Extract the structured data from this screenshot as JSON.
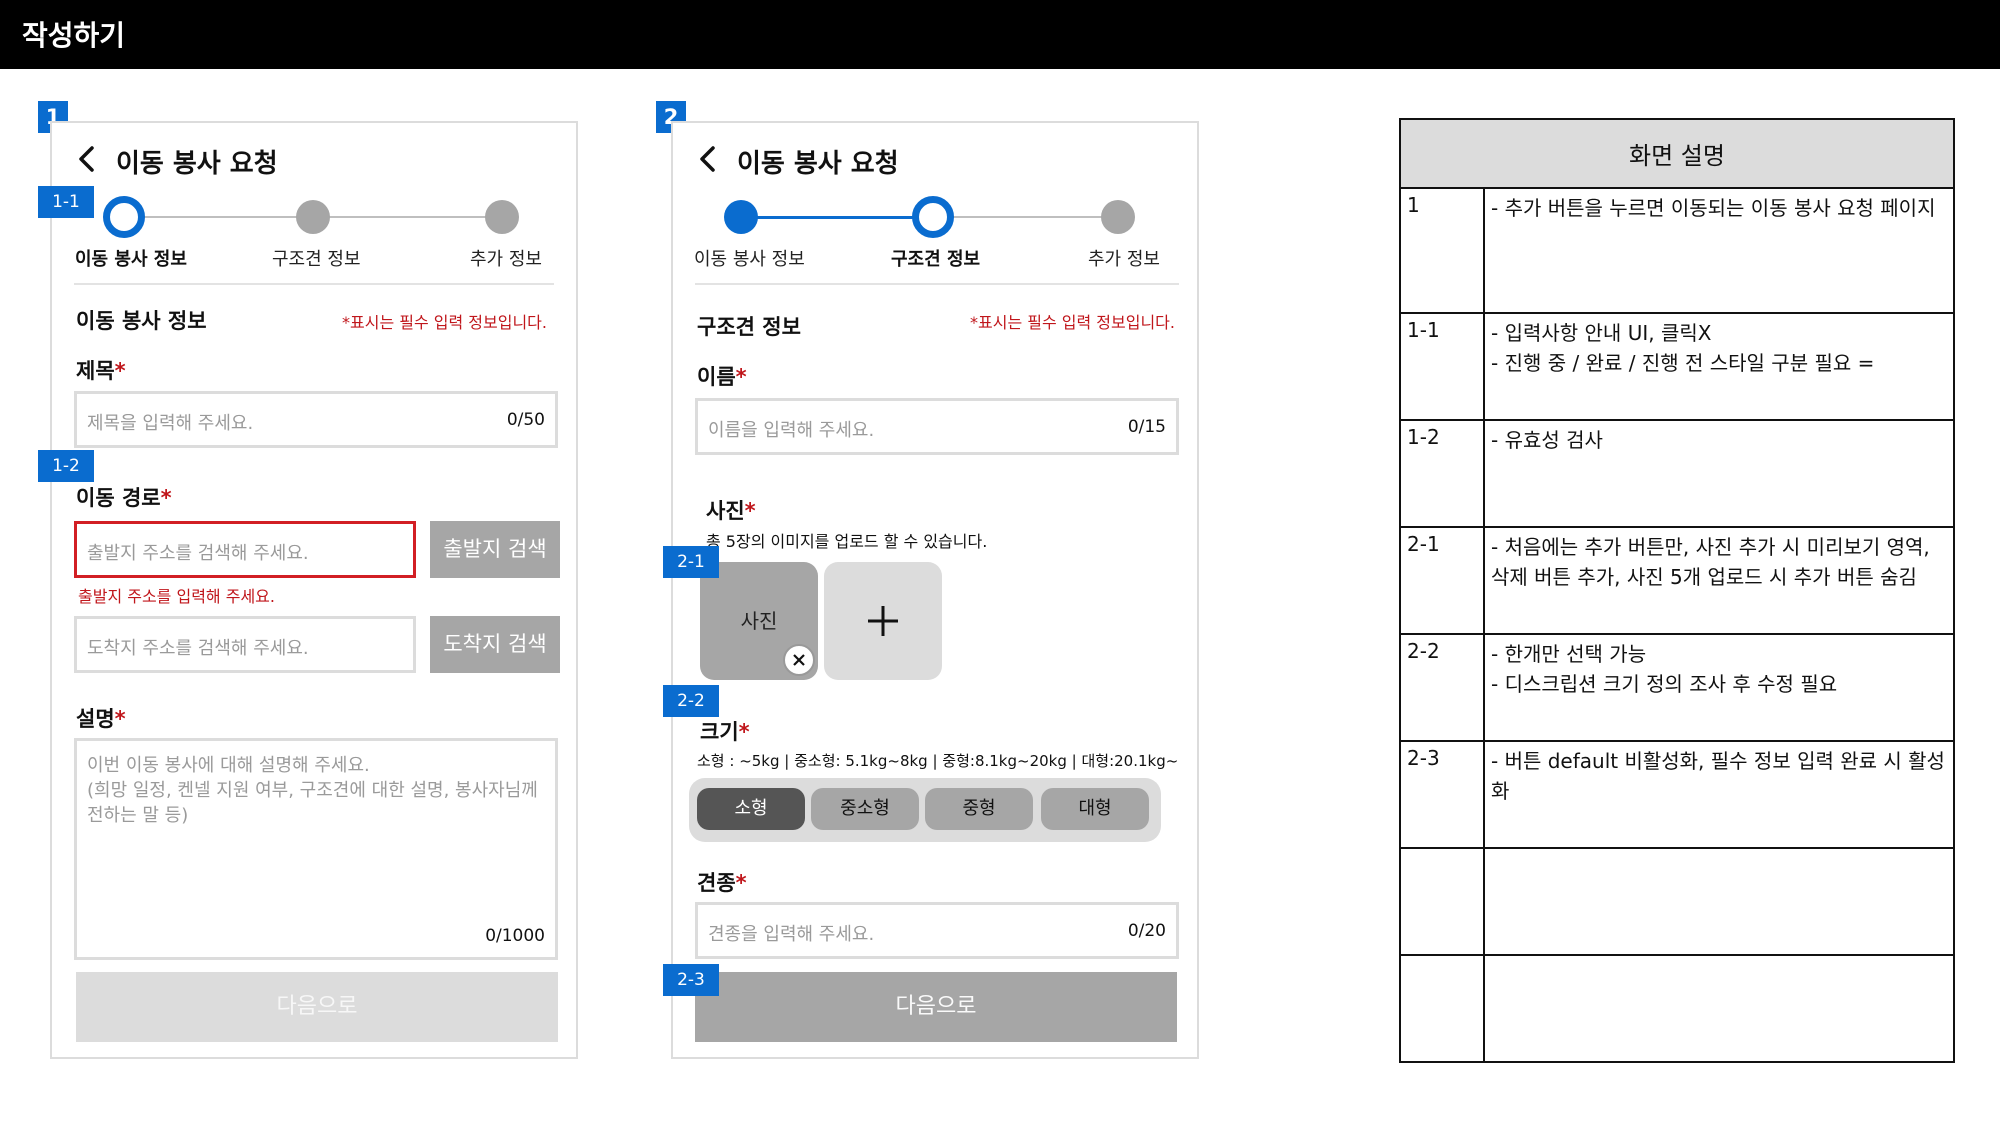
{
  "topbar": {
    "title": "작성하기"
  },
  "tags": {
    "s1": "1",
    "s1_1": "1-1",
    "s1_2": "1-2",
    "s2": "2",
    "s2_1": "2-1",
    "s2_2": "2-2",
    "s2_3": "2-3"
  },
  "screen1": {
    "header_title": "이동 봉사 요청",
    "steps": [
      {
        "label": "이동 봉사 정보",
        "state": "current"
      },
      {
        "label": "구조견 정보",
        "state": "pending"
      },
      {
        "label": "추가 정보",
        "state": "pending"
      }
    ],
    "section_title": "이동 봉사 정보",
    "required_note": "*표시는 필수 입력 정보입니다.",
    "title_field": {
      "label": "제목",
      "star": "*",
      "placeholder": "제목을 입력해 주세요.",
      "counter": "0/50"
    },
    "route": {
      "label": "이동 경로",
      "star": "*",
      "departure_placeholder": "출발지 주소를 검색해 주세요.",
      "departure_button": "출발지 검색",
      "departure_error": "출발지 주소를 입력해 주세요.",
      "arrival_placeholder": "도착지 주소를 검색해 주세요.",
      "arrival_button": "도착지 검색"
    },
    "description": {
      "label": "설명",
      "star": "*",
      "placeholder_line1": "이번 이동 봉사에 대해 설명해 주세요.",
      "placeholder_line2": "(희망 일정, 켄넬 지원 여부, 구조견에 대한 설명, 봉사자님께",
      "placeholder_line3": "전하는 말 등)",
      "counter": "0/1000"
    },
    "next_button": "다음으로"
  },
  "screen2": {
    "header_title": "이동 봉사 요청",
    "steps": [
      {
        "label": "이동 봉사 정보",
        "state": "done"
      },
      {
        "label": "구조견 정보",
        "state": "current"
      },
      {
        "label": "추가 정보",
        "state": "pending"
      }
    ],
    "section_title": "구조견 정보",
    "required_note": "*표시는 필수 입력 정보입니다.",
    "name_field": {
      "label": "이름",
      "star": "*",
      "placeholder": "이름을 입력해 주세요.",
      "counter": "0/15"
    },
    "photo": {
      "label": "사진",
      "star": "*",
      "helper": "총 5장의 이미지를 업로드 할 수 있습니다.",
      "tile_label": "사진",
      "remove_icon": "close-icon",
      "add_icon": "plus-icon"
    },
    "size": {
      "label": "크기",
      "star": "*",
      "helper": "소형 : ~5kg | 중소형: 5.1kg~8kg | 중형:8.1kg~20kg | 대형:20.1kg~",
      "options": [
        "소형",
        "중소형",
        "중형",
        "대형"
      ],
      "selected": "소형"
    },
    "breed_field": {
      "label": "견종",
      "star": "*",
      "placeholder": "견종을 입력해 주세요.",
      "counter": "0/20"
    },
    "next_button": "다음으로"
  },
  "description_table": {
    "header": "화면 설명",
    "rows": [
      {
        "id": "1",
        "lines": [
          "- 추가 버튼을 누르면 이동되는 이동 봉사 요청 페이지"
        ]
      },
      {
        "id": "1-1",
        "lines": [
          "- 입력사항 안내 UI, 클릭X",
          "- 진행 중 / 완료 / 진행 전 스타일 구분 필요 ="
        ]
      },
      {
        "id": "1-2",
        "lines": [
          "- 유효성 검사"
        ]
      },
      {
        "id": "2-1",
        "lines": [
          "- 처음에는 추가 버튼만, 사진 추가 시 미리보기 영역, 삭제 버튼 추가, 사진 5개 업로드 시 추가 버튼 숨김"
        ]
      },
      {
        "id": "2-2",
        "lines": [
          "- 한개만 선택 가능",
          "- 디스크립션 크기 정의 조사 후 수정 필요"
        ]
      },
      {
        "id": "2-3",
        "lines": [
          "- 버튼 default 비활성화, 필수 정보 입력 완료 시 활성화"
        ]
      },
      {
        "id": "",
        "lines": []
      },
      {
        "id": "",
        "lines": []
      }
    ]
  },
  "colors": {
    "accent": "#0a6ccf",
    "error": "#c0161b",
    "disabled": "#a6a6a6"
  }
}
